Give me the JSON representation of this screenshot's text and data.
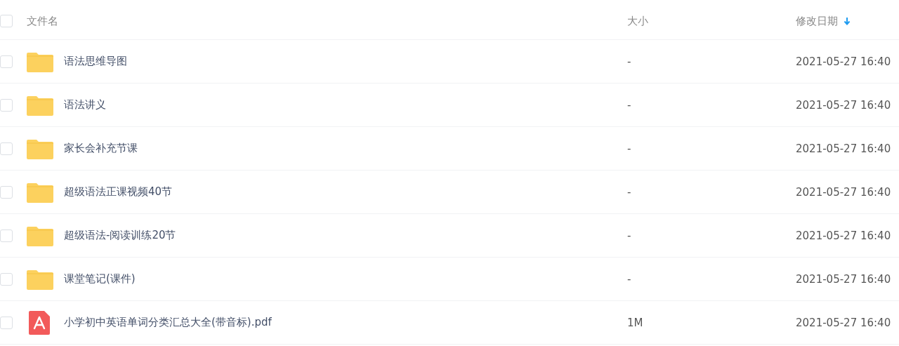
{
  "header": {
    "checked": false,
    "columns": [
      {
        "label": "文件名",
        "sorted": false
      },
      {
        "label": "大小",
        "sorted": false
      },
      {
        "label": "修改日期",
        "sorted": true
      }
    ]
  },
  "rows": [
    {
      "kind": "folder",
      "checked": false,
      "name": "语法思维导图",
      "size": "-",
      "date": "2021-05-27 16:40"
    },
    {
      "kind": "folder",
      "checked": false,
      "name": "语法讲义",
      "size": "-",
      "date": "2021-05-27 16:40"
    },
    {
      "kind": "folder",
      "checked": false,
      "name": "家长会补充节课",
      "size": "-",
      "date": "2021-05-27 16:40"
    },
    {
      "kind": "folder",
      "checked": false,
      "name": "超级语法正课视频40节",
      "size": "-",
      "date": "2021-05-27 16:40"
    },
    {
      "kind": "folder",
      "checked": false,
      "name": "超级语法-阅读训练20节",
      "size": "-",
      "date": "2021-05-27 16:40"
    },
    {
      "kind": "folder",
      "checked": false,
      "name": "课堂笔记(课件)",
      "size": "-",
      "date": "2021-05-27 16:40"
    },
    {
      "kind": "pdf",
      "checked": false,
      "name": "小学初中英语单词分类汇总大全(带音标).pdf",
      "size": "1M",
      "date": "2021-05-27 16:40"
    }
  ]
}
